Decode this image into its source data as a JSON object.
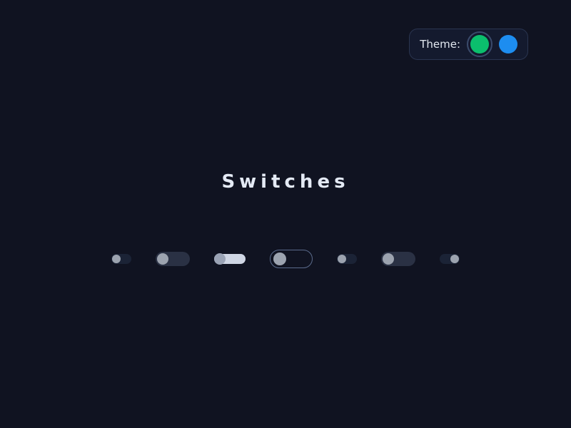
{
  "theme_picker": {
    "label": "Theme:",
    "swatches": [
      {
        "name": "green",
        "color": "#0bbf6d",
        "selected": true
      },
      {
        "name": "blue",
        "color": "#1d8df0",
        "selected": false
      }
    ]
  },
  "title": "Switches",
  "switches": [
    {
      "id": "switch-1",
      "size": "xs",
      "track": "darker",
      "on": false
    },
    {
      "id": "switch-2",
      "size": "sm",
      "track": "track",
      "on": false
    },
    {
      "id": "switch-3",
      "size": "sm2",
      "track": "light",
      "on": false
    },
    {
      "id": "switch-4",
      "size": "lg",
      "track": "outline",
      "on": false
    },
    {
      "id": "switch-5",
      "size": "xs",
      "track": "darker",
      "on": false
    },
    {
      "id": "switch-6",
      "size": "sm",
      "track": "track",
      "on": false
    },
    {
      "id": "switch-7",
      "size": "xs",
      "track": "darker",
      "on": true
    }
  ]
}
